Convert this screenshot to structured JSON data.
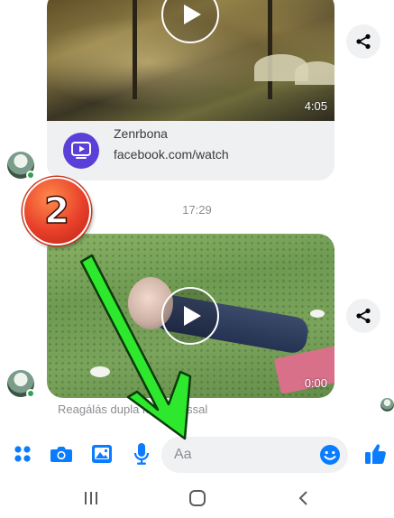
{
  "messages": [
    {
      "duration": "4:05",
      "source_title": "Zenrbona",
      "source_url": "facebook.com/watch"
    },
    {
      "duration": "0:00"
    }
  ],
  "timestamp": "17:29",
  "reaction_hint": "Reagálás dupla koppintással",
  "badge_number": "2",
  "composer": {
    "placeholder": "Aa"
  },
  "icons": {
    "apps": "four-dots-icon",
    "camera": "camera-icon",
    "gallery": "image-icon",
    "mic": "microphone-icon",
    "emoji": "smiley-icon",
    "like": "thumbs-up-icon",
    "share": "share-icon",
    "play": "play-icon",
    "nav_recents": "recents-icon",
    "nav_home": "home-icon",
    "nav_back": "back-icon"
  },
  "colors": {
    "accent": "#0a7cff",
    "online": "#31a24c",
    "annotation_arrow": "#2ee82e",
    "badge": "#e8402a"
  }
}
